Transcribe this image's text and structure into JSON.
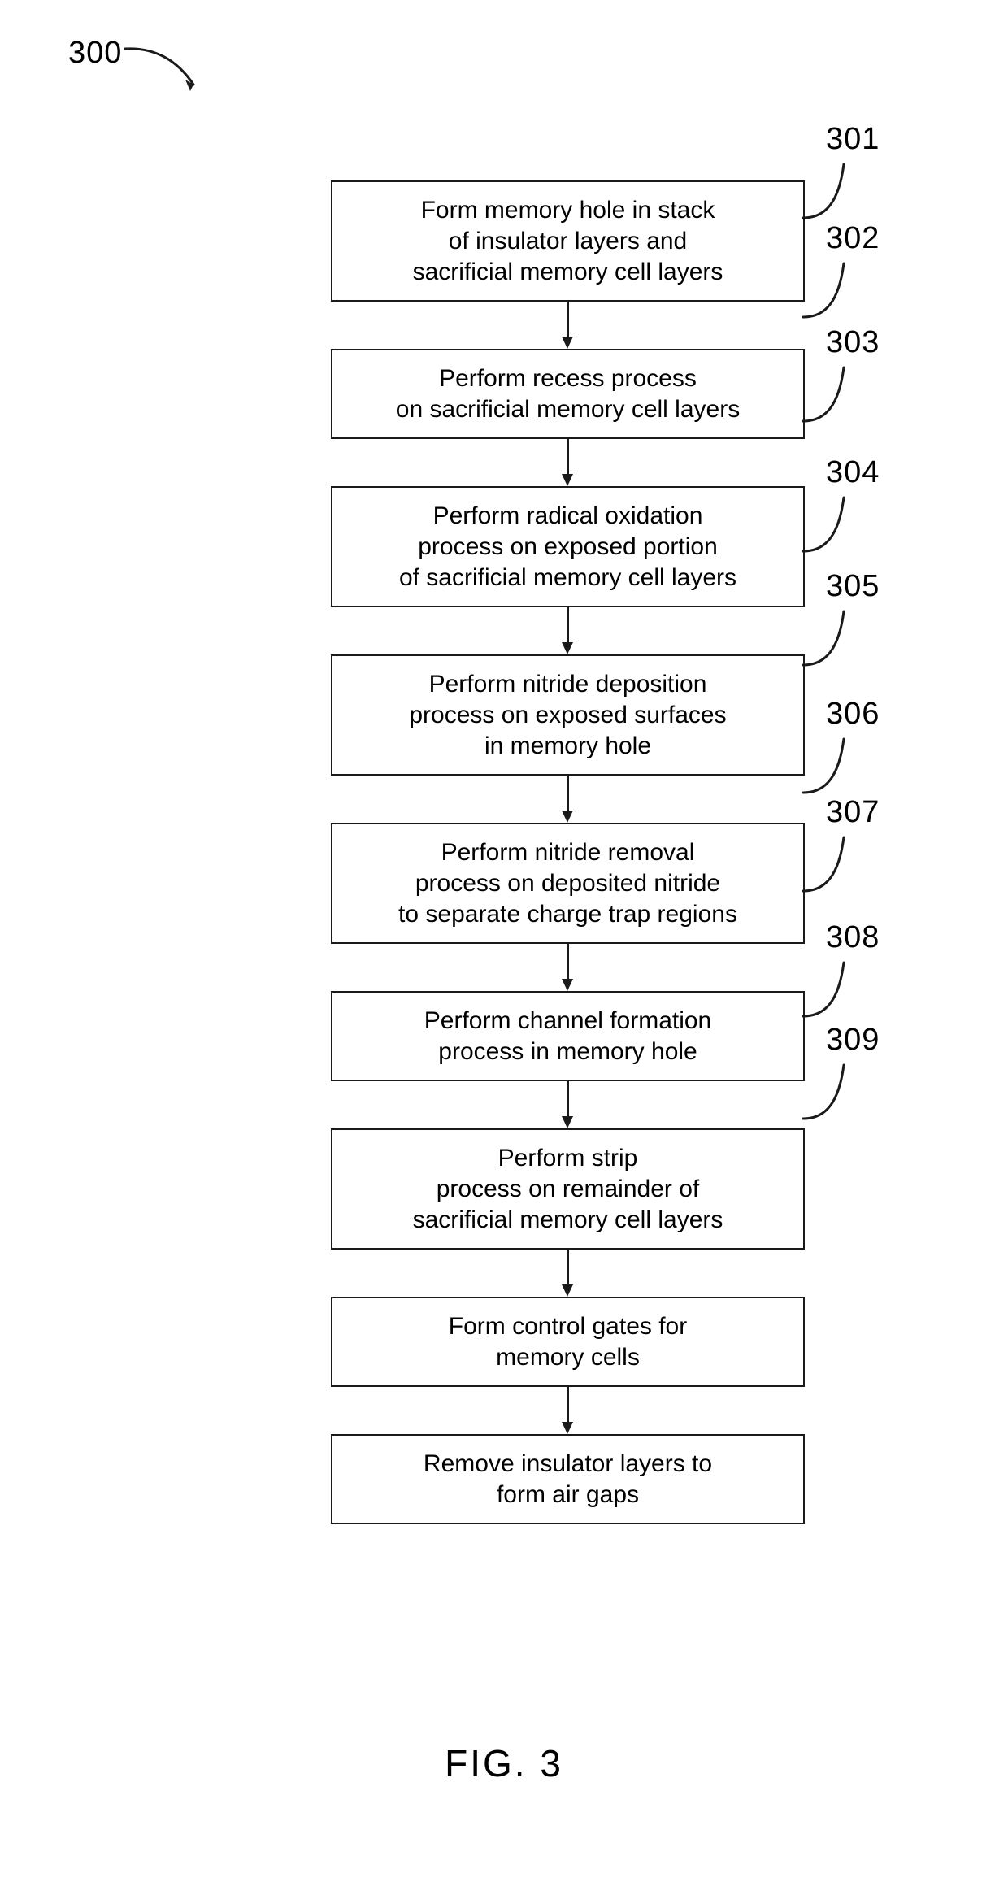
{
  "figure": {
    "number_label": "300",
    "caption": "FIG. 3"
  },
  "steps": [
    {
      "ref": "301",
      "lines": [
        "Form memory hole in stack",
        "of insulator layers and",
        "sacrificial memory cell layers"
      ],
      "text": "Form memory hole in stack of insulator layers and sacrificial memory cell layers"
    },
    {
      "ref": "302",
      "lines": [
        "Perform recess process",
        "on sacrificial memory cell layers"
      ],
      "text": "Perform recess process on sacrificial memory cell layers"
    },
    {
      "ref": "303",
      "lines": [
        "Perform radical oxidation",
        "process on exposed portion",
        "of sacrificial memory cell layers"
      ],
      "text": "Perform radical oxidation process on exposed portion of sacrificial memory cell layers"
    },
    {
      "ref": "304",
      "lines": [
        "Perform nitride deposition",
        "process on exposed surfaces",
        "in memory hole"
      ],
      "text": "Perform nitride deposition process on exposed surfaces in memory hole"
    },
    {
      "ref": "305",
      "lines": [
        "Perform nitride removal",
        "process on deposited nitride",
        "to separate charge trap regions"
      ],
      "text": "Perform nitride removal process on deposited nitride to separate charge trap regions"
    },
    {
      "ref": "306",
      "lines": [
        "Perform channel formation",
        "process in memory hole"
      ],
      "text": "Perform channel formation process in memory hole"
    },
    {
      "ref": "307",
      "lines": [
        "Perform strip",
        "process on remainder of",
        "sacrificial memory cell layers"
      ],
      "text": "Perform strip process on remainder of sacrificial memory cell layers"
    },
    {
      "ref": "308",
      "lines": [
        "Form control gates for",
        "memory cells"
      ],
      "text": "Form control gates for memory cells"
    },
    {
      "ref": "309",
      "lines": [
        "Remove insulator layers to",
        "form air gaps"
      ],
      "text": "Remove insulator layers to form air gaps"
    }
  ],
  "colors": {
    "stroke": "#1a1a1a",
    "background": "#ffffff",
    "text": "#000000"
  }
}
